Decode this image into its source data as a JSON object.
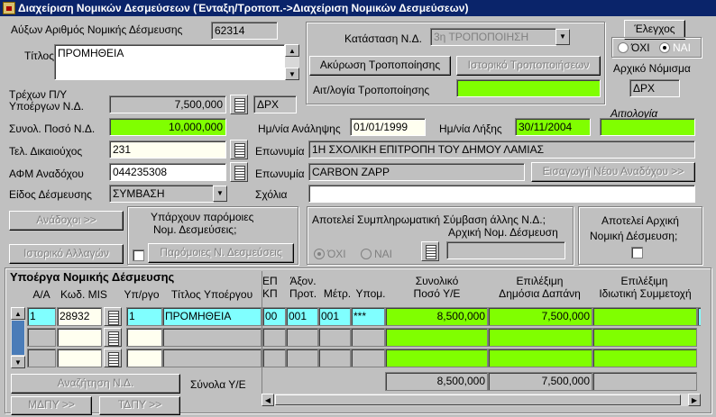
{
  "window": {
    "title": "Διαχείριση Νομικών Δεσμεύσεων (Ένταξη/Τροποπ.->Διαχείριση Νομικών Δεσμεύσεων)"
  },
  "header": {
    "aa_label": "Αύξων Αριθμός Νομικής Δέσμευσης",
    "aa_value": "62314",
    "title_label": "Τίτλος",
    "title_value": "ΠΡΟΜΗΘΕΙΑ",
    "status_label": "Κατάσταση Ν.Δ.",
    "status_value": "3η ΤΡΟΠΟΠΟΙΗΣΗ",
    "cancel_mod_button": "Ακύρωση Τροποποίησης",
    "history_mod_button": "Ιστορικό Τροποποιήσεων",
    "mod_reason_label": "Αιτ/λογία Τροποποίησης",
    "mod_reason_value": "",
    "check_button": "Έλεγχος",
    "radio_no": "ΌΧΙ",
    "radio_yes": "ΝΑΙ",
    "orig_currency_label": "Αρχικό Νόμισμα",
    "orig_currency_value": "ΔΡΧ"
  },
  "amounts": {
    "current_label_1": "Τρέχων Π/Υ",
    "current_label_2": "Υποέργων Ν.Δ.",
    "current_value": "7,500,000",
    "current_currency": "ΔΡΧ",
    "total_label": "Συνολ. Ποσό Ν.Δ.",
    "total_value": "10,000,000",
    "start_date_label": "Ημ/νία Ανάληψης",
    "start_date_value": "01/01/1999",
    "end_date_label": "Ημ/νία Λήξης",
    "end_date_value": "30/11/2004",
    "justification_label": "Αιτιολογία",
    "justification_value": "",
    "beneficiary_label": "Τελ. Δικαιούχος",
    "beneficiary_code": "231",
    "beneficiary_name_label": "Επωνυμία",
    "beneficiary_name": "1Η ΣΧΟΛΙΚΗ ΕΠΙΤΡΟΠΗ ΤΟΥ ΔΗΜΟΥ ΛΑΜΙΑΣ",
    "contractor_afm_label": "ΑΦΜ Αναδόχου",
    "contractor_afm": "044235308",
    "contractor_name_label": "Επωνυμία",
    "contractor_name": "CARBON ZAPP",
    "new_contractor_button": "Εισαγωγή Νέου Αναδόχου >>",
    "commitment_type_label": "Είδος Δέσμευσης",
    "commitment_type_value": "ΣΥΜΒΑΣΗ",
    "comments_label": "Σχόλια",
    "comments_value": ""
  },
  "middle": {
    "contractors_button": "Ανάδοχοι >>",
    "change_history_button": "Ιστορικό Αλλαγών",
    "similar_label_1": "Υπάρχουν παρόμοιες",
    "similar_label_2": "Νομ. Δεσμεύσεις;",
    "similar_button": "Παρόμοιες Ν. Δεσμεύσεις",
    "supplementary_label": "Αποτελεί Συμπληρωματική Σύμβαση άλλης Ν.Δ.;",
    "radio_no": "ΌΧΙ",
    "radio_yes": "ΝΑΙ",
    "initial_commitment_label": "Αρχική Νομ. Δέσμευση",
    "initial_commitment_value": "",
    "is_initial_label_1": "Αποτελεί Αρχική",
    "is_initial_label_2": "Νομική Δέσμευση;"
  },
  "subprojects": {
    "section_title": "Υποέργα Νομικής Δέσμευσης",
    "headers": {
      "aa": "Α/Α",
      "mis": "Κωδ. MIS",
      "subproject": "Υπ/ργο",
      "subproject_title": "Τίτλος Υποέργου",
      "ep_1": "ΕΠ",
      "ep_2": "ΚΠ",
      "axis_1": "Άξον.",
      "axis_2": "Προτ.",
      "measure": "Μέτρ.",
      "action": "Υπομ.",
      "total_1": "Συνολικό",
      "total_2": "Ποσό Υ/Ε",
      "public_1": "Επιλέξιμη",
      "public_2": "Δημόσια Δαπάνη",
      "private_1": "Επιλέξιμη",
      "private_2": "Ιδιωτική Συμμετοχή"
    },
    "rows": [
      {
        "aa": "1",
        "mis": "28932",
        "subproject": "1",
        "title": "ΠΡΟΜΗΘΕΙΑ",
        "ep": "00",
        "axis": "001",
        "measure": "001",
        "action": "***",
        "total": "8,500,000",
        "public": "7,500,000",
        "private": ""
      },
      {
        "aa": "",
        "mis": "",
        "subproject": "",
        "title": "",
        "ep": "",
        "axis": "",
        "measure": "",
        "action": "",
        "total": "",
        "public": "",
        "private": ""
      },
      {
        "aa": "",
        "mis": "",
        "subproject": "",
        "title": "",
        "ep": "",
        "axis": "",
        "measure": "",
        "action": "",
        "total": "",
        "public": "",
        "private": ""
      }
    ],
    "search_button": "Αναζήτηση Ν.Δ.",
    "totals_label": "Σύνολα Υ/Ε",
    "totals_total": "8,500,000",
    "totals_public": "7,500,000",
    "totals_private": "",
    "mdpy_button": "ΜΔΠΥ >>",
    "tdpy_button": "ΤΔΠΥ >>"
  }
}
